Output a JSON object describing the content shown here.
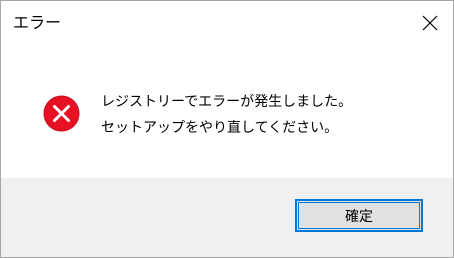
{
  "window": {
    "title": "エラー",
    "close_icon": "close-icon"
  },
  "message": {
    "icon": "error-icon",
    "line1": "レジストリーでエラーが発生しました。",
    "line2": "セットアップをやり直してください。"
  },
  "buttons": {
    "ok_label": "確定"
  },
  "colors": {
    "error_red": "#e81123",
    "accent_blue": "#0078d7",
    "footer_bg": "#f0f0f0"
  }
}
